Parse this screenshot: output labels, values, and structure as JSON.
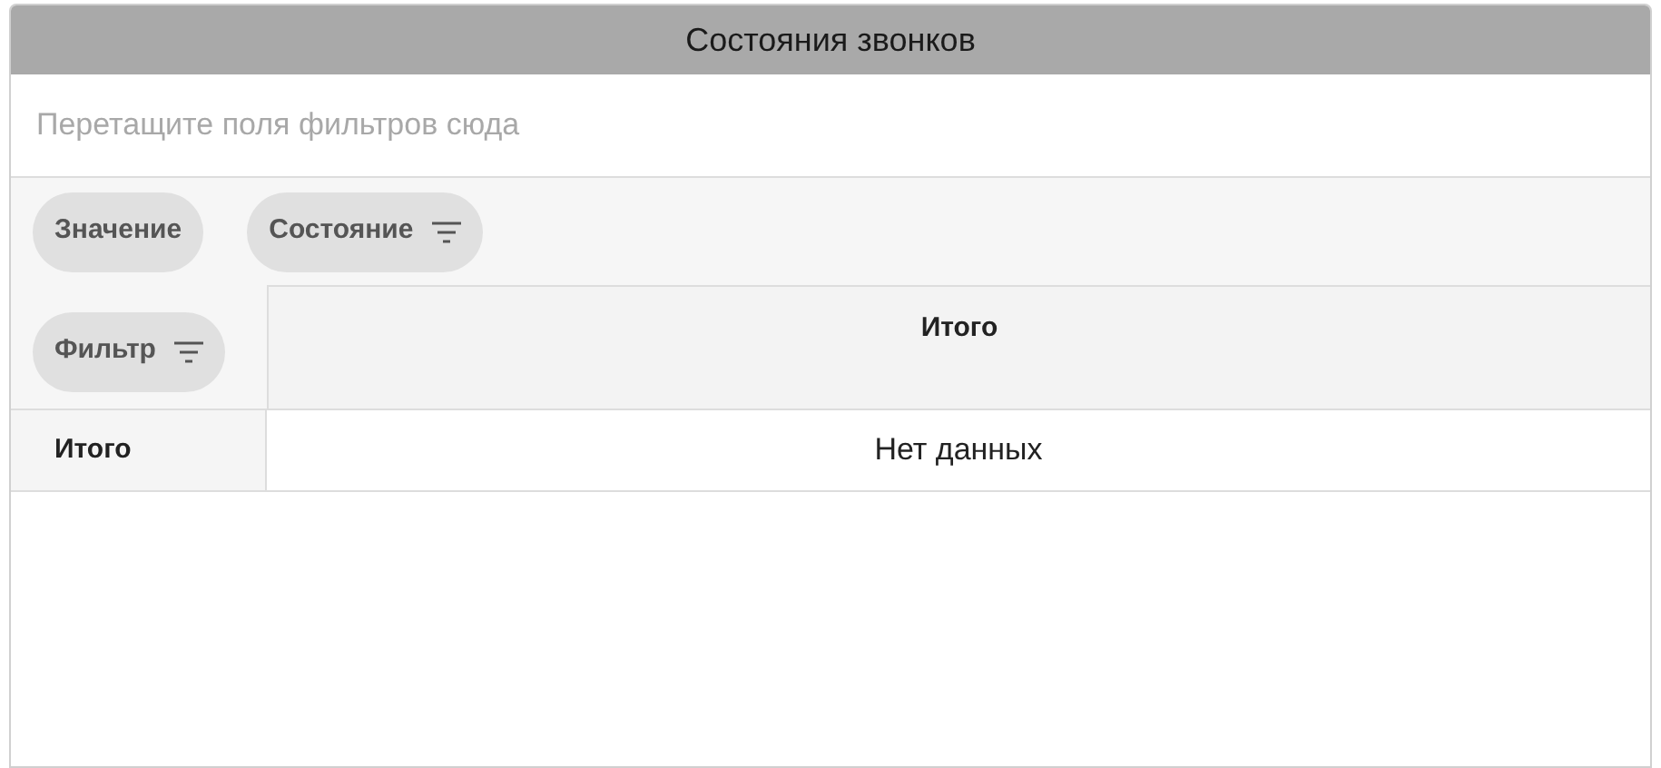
{
  "title": "Состояния звонков",
  "filter_area": {
    "hint": "Перетащите поля фильтров сюда"
  },
  "data_fields": [
    {
      "label": "Значение",
      "filter": false
    }
  ],
  "column_fields": [
    {
      "label": "Состояние",
      "filter": true
    }
  ],
  "row_fields": [
    {
      "label": "Фильтр",
      "filter": true
    }
  ],
  "column_header": "Итого",
  "rows": [
    {
      "header": "Итого",
      "value": "Нет данных"
    }
  ]
}
